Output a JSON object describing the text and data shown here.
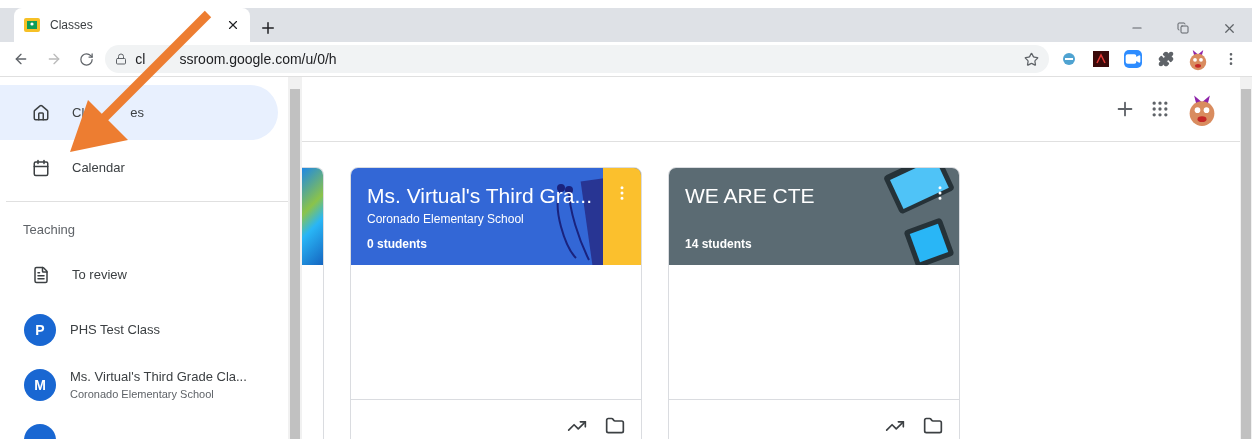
{
  "browser": {
    "tab": {
      "title": "Classes",
      "selected": true
    },
    "url_parts": [
      "cl",
      "ssroom.google.com/u/0/h"
    ]
  },
  "sidebar": {
    "items": [
      {
        "kind": "home",
        "label_parts": [
          "Cl",
          "es"
        ],
        "selected": true
      },
      {
        "kind": "calendar",
        "label": "Calendar",
        "selected": false
      }
    ],
    "section": "Teaching",
    "teaching": [
      {
        "kind": "review",
        "label": "To review",
        "selected": false
      },
      {
        "kind": "class",
        "initial": "P",
        "label": "PHS Test Class",
        "selected": false
      },
      {
        "kind": "class",
        "initial": "M",
        "label": "Ms. Virtual's Third Grade Cla...",
        "subtitle": "Coronado Elementary School",
        "selected": false
      }
    ]
  },
  "cards": [
    {
      "kind": "headphones",
      "title": "Ms. Virtual's Third Gra...",
      "subtitle": "Coronado Elementary School",
      "count": "0 students",
      "color": "#3367d6"
    },
    {
      "kind": "tablets",
      "title": "WE ARE CTE",
      "count": "14 students",
      "color": "#5b6b73"
    }
  ]
}
